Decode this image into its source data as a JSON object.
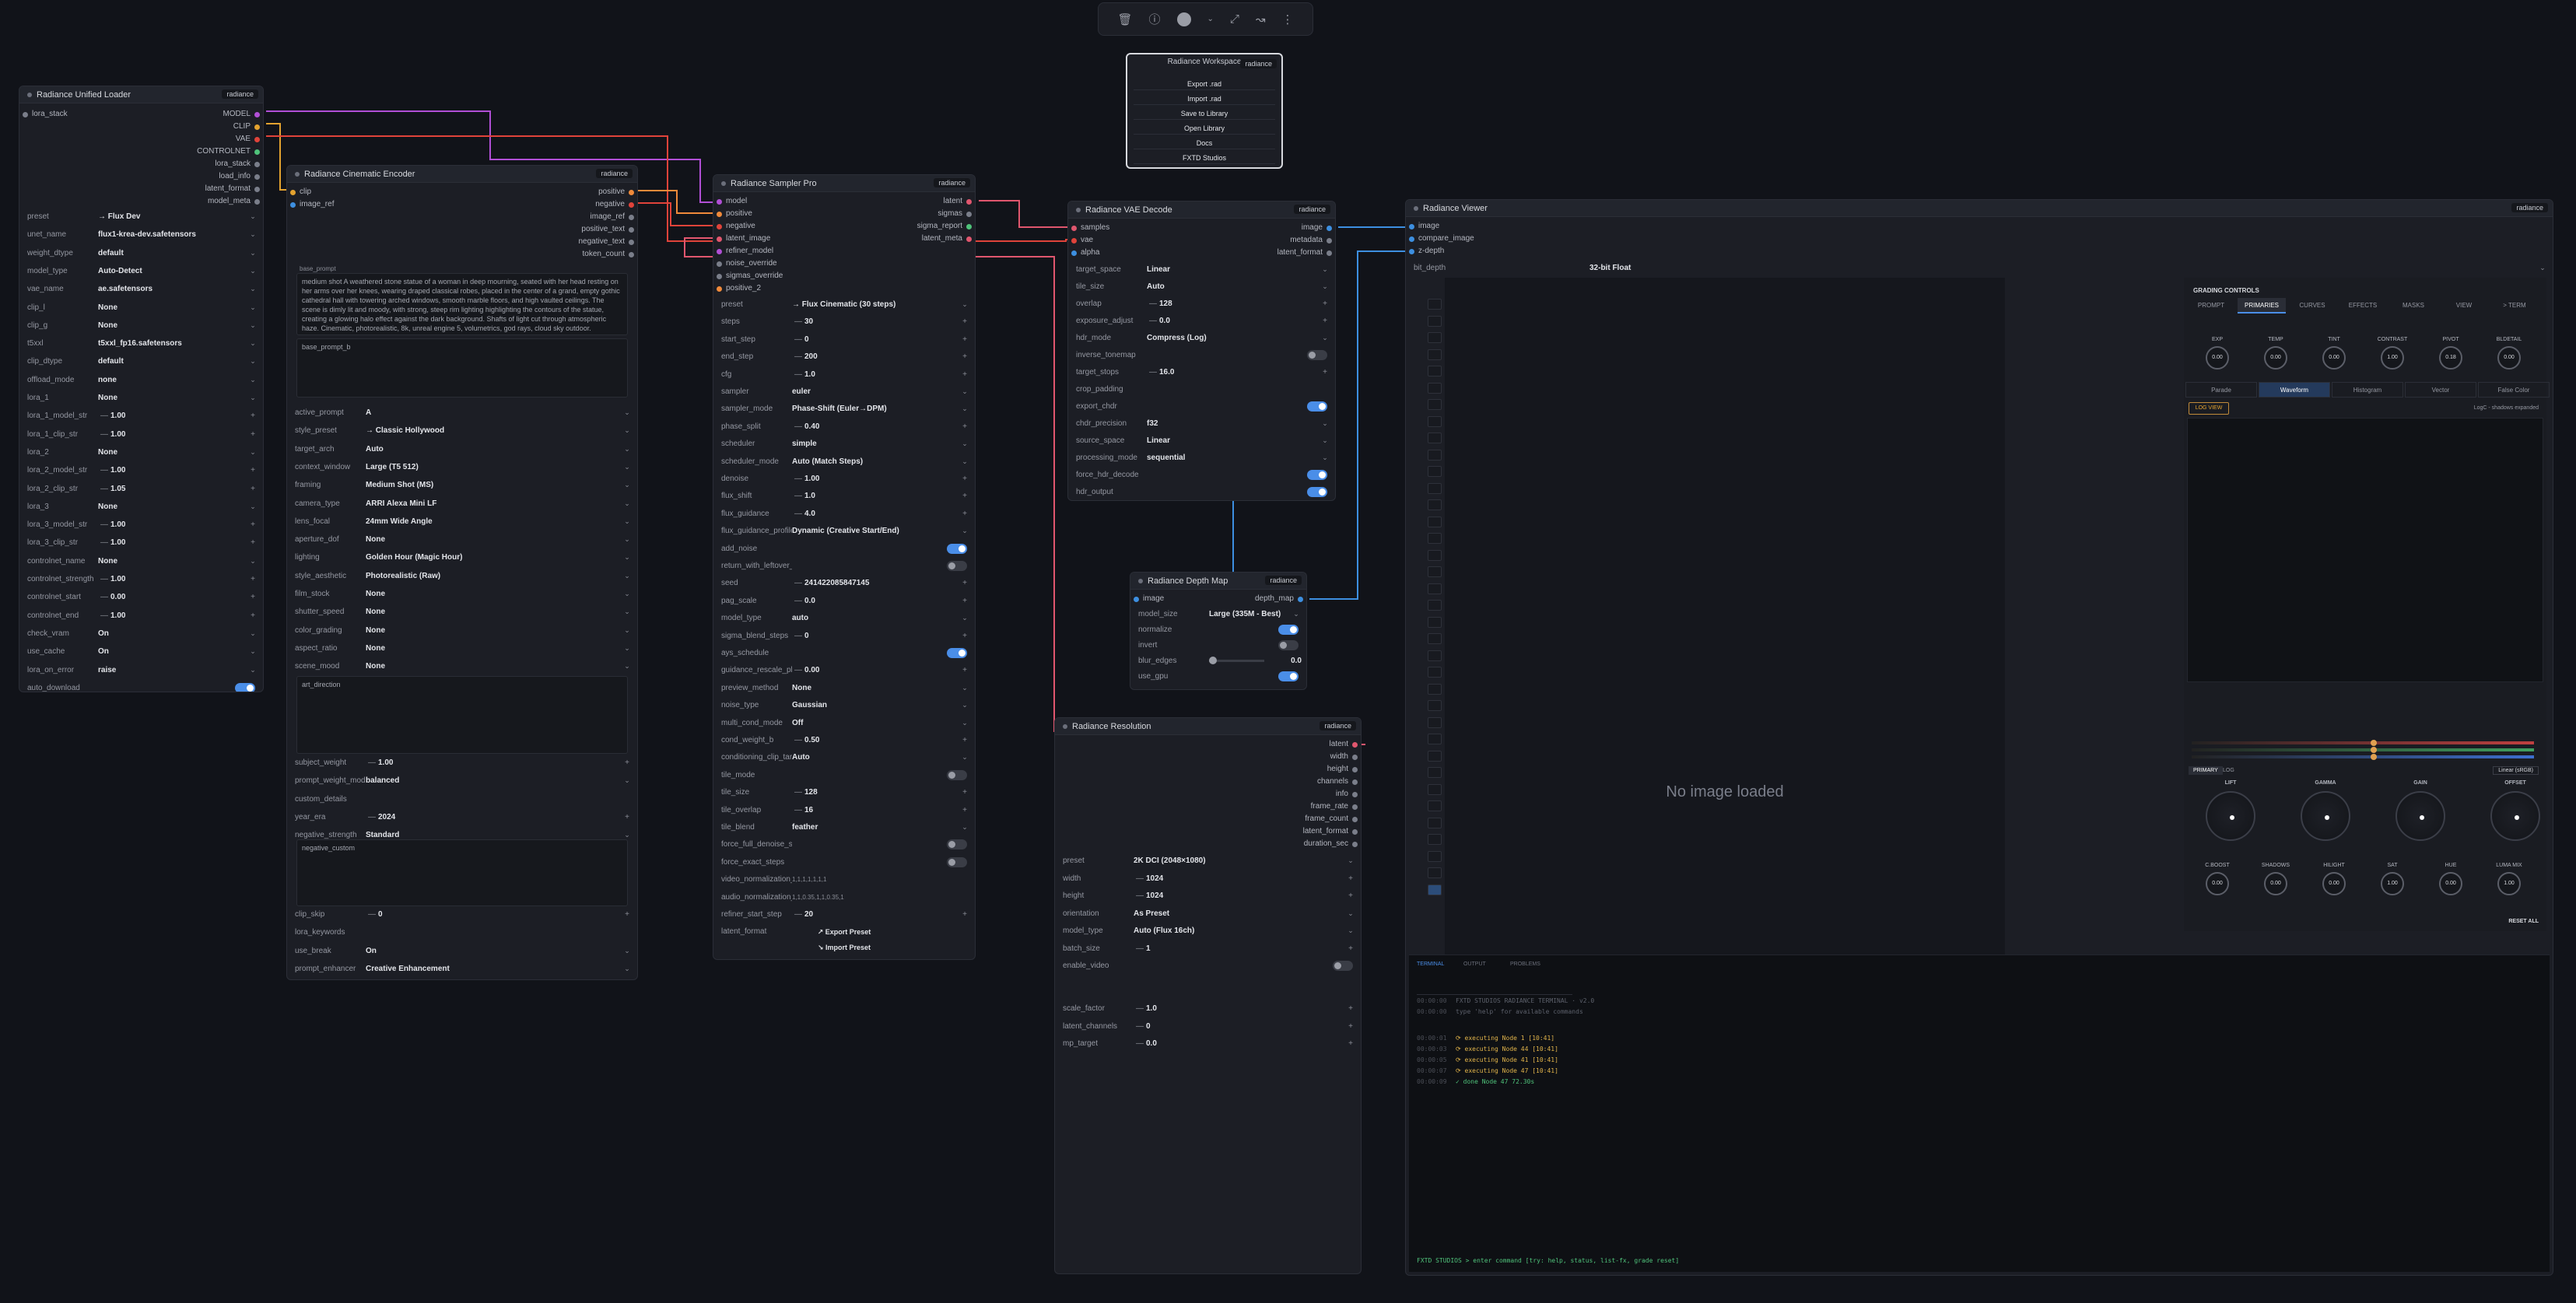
{
  "toolbar": {
    "icons": [
      "trash-icon",
      "info-icon",
      "color-circle-icon",
      "chevron-down-icon",
      "fit-icon",
      "curve-icon",
      "more-icon"
    ]
  },
  "workspace": {
    "title": "Radiance Workspace",
    "badge": "radiance",
    "items": [
      "Export .rad",
      "Import .rad",
      "Save to Library",
      "Open Library",
      "Docs",
      "FXTD Studios"
    ]
  },
  "loader": {
    "title": "Radiance Unified Loader",
    "badge": "radiance",
    "input": "lora_stack",
    "outputs": [
      "MODEL",
      "CLIP",
      "VAE",
      "CONTROLNET",
      "lora_stack",
      "load_info",
      "latent_format",
      "model_meta"
    ],
    "widgets": [
      {
        "l": "preset",
        "v": "→ Flux Dev",
        "t": "combo"
      },
      {
        "l": "unet_name",
        "v": "flux1-krea-dev.safetensors",
        "t": "combo"
      },
      {
        "l": "weight_dtype",
        "v": "default",
        "t": "combo"
      },
      {
        "l": "model_type",
        "v": "Auto-Detect",
        "t": "combo"
      },
      {
        "l": "vae_name",
        "v": "ae.safetensors",
        "t": "combo"
      },
      {
        "l": "clip_l",
        "v": "None",
        "t": "combo"
      },
      {
        "l": "clip_g",
        "v": "None",
        "t": "combo"
      },
      {
        "l": "t5xxl",
        "v": "t5xxl_fp16.safetensors",
        "t": "combo"
      },
      {
        "l": "clip_dtype",
        "v": "default",
        "t": "combo"
      },
      {
        "l": "offload_mode",
        "v": "none",
        "t": "combo"
      },
      {
        "l": "lora_1",
        "v": "None",
        "t": "combo"
      },
      {
        "l": "lora_1_model_str",
        "v": "1.00",
        "t": "num"
      },
      {
        "l": "lora_1_clip_str",
        "v": "1.00",
        "t": "num"
      },
      {
        "l": "lora_2",
        "v": "None",
        "t": "combo"
      },
      {
        "l": "lora_2_model_str",
        "v": "1.00",
        "t": "num"
      },
      {
        "l": "lora_2_clip_str",
        "v": "1.05",
        "t": "num"
      },
      {
        "l": "lora_3",
        "v": "None",
        "t": "combo"
      },
      {
        "l": "lora_3_model_str",
        "v": "1.00",
        "t": "num"
      },
      {
        "l": "lora_3_clip_str",
        "v": "1.00",
        "t": "num"
      },
      {
        "l": "controlnet_name",
        "v": "None",
        "t": "combo"
      },
      {
        "l": "controlnet_strength",
        "v": "1.00",
        "t": "num"
      },
      {
        "l": "controlnet_start",
        "v": "0.00",
        "t": "num"
      },
      {
        "l": "controlnet_end",
        "v": "1.00",
        "t": "num"
      },
      {
        "l": "check_vram",
        "v": "On",
        "t": "combo"
      },
      {
        "l": "use_cache",
        "v": "On",
        "t": "combo"
      },
      {
        "l": "lora_on_error",
        "v": "raise",
        "t": "combo"
      },
      {
        "l": "auto_download",
        "v": "",
        "t": "toggle_on"
      }
    ]
  },
  "encoder": {
    "title": "Radiance Cinematic Encoder",
    "badge": "radiance",
    "inputs": [
      "clip",
      "image_ref"
    ],
    "outputs": [
      "positive",
      "negative",
      "image_ref",
      "positive_text",
      "negative_text",
      "token_count"
    ],
    "base_prompt_label": "base_prompt",
    "base_prompt": "medium shot A weathered stone statue of a woman in deep mourning, seated with her head resting on her arms over her knees, wearing draped classical robes, placed in the center of a grand, empty gothic cathedral hall with towering arched windows, smooth marble floors, and high vaulted ceilings. The scene is dimly lit and moody, with strong, steep rim lighting highlighting the contours of the statue, creating a glowing halo effect against the dark background. Shafts of light cut through atmospheric haze. Cinematic, photorealistic, 8k, unreal engine 5, volumetrics, god rays, cloud sky outdoor.",
    "base_prompt_b": "base_prompt_b",
    "widgets": [
      {
        "l": "active_prompt",
        "v": "A",
        "t": "combo"
      },
      {
        "l": "style_preset",
        "v": "→ Classic Hollywood",
        "t": "combo"
      },
      {
        "l": "target_arch",
        "v": "Auto",
        "t": "combo"
      },
      {
        "l": "context_window",
        "v": "Large (T5 512)",
        "t": "combo"
      },
      {
        "l": "framing",
        "v": "Medium Shot (MS)",
        "t": "combo"
      },
      {
        "l": "camera_type",
        "v": "ARRI Alexa Mini LF",
        "t": "combo"
      },
      {
        "l": "lens_focal",
        "v": "24mm Wide Angle",
        "t": "combo"
      },
      {
        "l": "aperture_dof",
        "v": "None",
        "t": "combo"
      },
      {
        "l": "lighting",
        "v": "Golden Hour (Magic Hour)",
        "t": "combo"
      },
      {
        "l": "style_aesthetic",
        "v": "Photorealistic (Raw)",
        "t": "combo"
      },
      {
        "l": "film_stock",
        "v": "None",
        "t": "combo"
      },
      {
        "l": "shutter_speed",
        "v": "None",
        "t": "combo"
      },
      {
        "l": "color_grading",
        "v": "None",
        "t": "combo"
      },
      {
        "l": "aspect_ratio",
        "v": "None",
        "t": "combo"
      },
      {
        "l": "scene_mood",
        "v": "None",
        "t": "combo"
      }
    ],
    "art_direction": "art_direction",
    "widgets2": [
      {
        "l": "subject_weight",
        "v": "1.00",
        "t": "num"
      },
      {
        "l": "prompt_weight_mode",
        "v": "balanced",
        "t": "combo"
      },
      {
        "l": "custom_details",
        "v": "",
        "t": "label"
      },
      {
        "l": "year_era",
        "v": "2024",
        "t": "num"
      },
      {
        "l": "negative_strength",
        "v": "Standard",
        "t": "combo"
      }
    ],
    "negative_custom": "negative_custom",
    "widgets3": [
      {
        "l": "clip_skip",
        "v": "0",
        "t": "num"
      },
      {
        "l": "lora_keywords",
        "v": "",
        "t": "label"
      },
      {
        "l": "use_break",
        "v": "On",
        "t": "combo"
      },
      {
        "l": "prompt_enhancer",
        "v": "Creative Enhancement",
        "t": "combo"
      }
    ]
  },
  "sampler": {
    "title": "Radiance Sampler Pro",
    "badge": "radiance",
    "inputs": [
      "model",
      "positive",
      "negative",
      "latent_image",
      "refiner_model",
      "noise_override",
      "sigmas_override",
      "positive_2"
    ],
    "outputs": [
      "latent",
      "sigmas",
      "sigma_report",
      "latent_meta"
    ],
    "widgets": [
      {
        "l": "preset",
        "v": "→ Flux Cinematic (30 steps)",
        "t": "combo"
      },
      {
        "l": "steps",
        "v": "30",
        "t": "num"
      },
      {
        "l": "start_step",
        "v": "0",
        "t": "num"
      },
      {
        "l": "end_step",
        "v": "200",
        "t": "num"
      },
      {
        "l": "cfg",
        "v": "1.0",
        "t": "num"
      },
      {
        "l": "sampler",
        "v": "euler",
        "t": "combo"
      },
      {
        "l": "sampler_mode",
        "v": "Phase-Shift (Euler→DPM)",
        "t": "combo"
      },
      {
        "l": "phase_split",
        "v": "0.40",
        "t": "num"
      },
      {
        "l": "scheduler",
        "v": "simple",
        "t": "combo"
      },
      {
        "l": "scheduler_mode",
        "v": "Auto (Match Steps)",
        "t": "combo"
      },
      {
        "l": "denoise",
        "v": "1.00",
        "t": "num"
      },
      {
        "l": "flux_shift",
        "v": "1.0",
        "t": "num"
      },
      {
        "l": "flux_guidance",
        "v": "4.0",
        "t": "num"
      },
      {
        "l": "flux_guidance_profile",
        "v": "Dynamic (Creative Start/End)",
        "t": "combo"
      },
      {
        "l": "add_noise",
        "v": "",
        "t": "toggle_on"
      },
      {
        "l": "return_with_leftover_noise",
        "v": "",
        "t": "toggle_off"
      },
      {
        "l": "seed",
        "v": "241422085847145",
        "t": "num"
      },
      {
        "l": "pag_scale",
        "v": "0.0",
        "t": "num"
      },
      {
        "l": "model_type",
        "v": "auto",
        "t": "combo"
      },
      {
        "l": "sigma_blend_steps",
        "v": "0",
        "t": "num"
      },
      {
        "l": "ays_schedule",
        "v": "",
        "t": "toggle_on"
      },
      {
        "l": "guidance_rescale_phi",
        "v": "0.00",
        "t": "num"
      },
      {
        "l": "preview_method",
        "v": "None",
        "t": "combo"
      },
      {
        "l": "noise_type",
        "v": "Gaussian",
        "t": "combo"
      },
      {
        "l": "multi_cond_mode",
        "v": "Off",
        "t": "combo"
      },
      {
        "l": "cond_weight_b",
        "v": "0.50",
        "t": "num"
      },
      {
        "l": "conditioning_clip_target",
        "v": "Auto",
        "t": "combo"
      },
      {
        "l": "tile_mode",
        "v": "",
        "t": "toggle_off"
      },
      {
        "l": "tile_size",
        "v": "128",
        "t": "num"
      },
      {
        "l": "tile_overlap",
        "v": "16",
        "t": "num"
      },
      {
        "l": "tile_blend",
        "v": "feather",
        "t": "combo"
      },
      {
        "l": "force_full_denoise_steps",
        "v": "",
        "t": "toggle_off"
      },
      {
        "l": "force_exact_steps",
        "v": "",
        "t": "toggle_off"
      },
      {
        "l": "video_normalization_factors",
        "v": "1,1,1,1,1,1,1",
        "t": "text"
      },
      {
        "l": "audio_normalization_factors",
        "v": "1,1,0.35,1,1,0.35,1",
        "t": "text"
      },
      {
        "l": "refiner_start_step",
        "v": "20",
        "t": "num"
      },
      {
        "l": "latent_format",
        "v": "",
        "t": "label"
      }
    ],
    "export_preset": "↗ Export Preset",
    "import_preset": "↘ Import Preset"
  },
  "vae": {
    "title": "Radiance VAE Decode",
    "badge": "radiance",
    "inputs": [
      "samples",
      "vae",
      "alpha"
    ],
    "outputs": [
      "image",
      "metadata",
      "latent_format"
    ],
    "widgets": [
      {
        "l": "target_space",
        "v": "Linear",
        "t": "combo"
      },
      {
        "l": "tile_size",
        "v": "Auto",
        "t": "combo"
      },
      {
        "l": "overlap",
        "v": "128",
        "t": "num"
      },
      {
        "l": "exposure_adjust",
        "v": "0.0",
        "t": "num"
      },
      {
        "l": "hdr_mode",
        "v": "Compress (Log)",
        "t": "combo"
      },
      {
        "l": "inverse_tonemap",
        "v": "",
        "t": "toggle_off"
      },
      {
        "l": "target_stops",
        "v": "16.0",
        "t": "num"
      },
      {
        "l": "crop_padding",
        "v": "",
        "t": "label"
      },
      {
        "l": "export_chdr",
        "v": "",
        "t": "toggle_on"
      },
      {
        "l": "chdr_precision",
        "v": "f32",
        "t": "combo"
      },
      {
        "l": "source_space",
        "v": "Linear",
        "t": "combo"
      },
      {
        "l": "processing_mode",
        "v": "sequential",
        "t": "combo"
      },
      {
        "l": "force_hdr_decode",
        "v": "",
        "t": "toggle_on"
      },
      {
        "l": "hdr_output",
        "v": "",
        "t": "toggle_on"
      }
    ]
  },
  "depth": {
    "title": "Radiance Depth Map",
    "badge": "radiance",
    "input": "image",
    "output": "depth_map",
    "widgets": [
      {
        "l": "model_size",
        "v": "Large (335M - Best)",
        "t": "combo"
      },
      {
        "l": "normalize",
        "v": "",
        "t": "toggle_on"
      },
      {
        "l": "invert",
        "v": "",
        "t": "toggle_off"
      },
      {
        "l": "blur_edges",
        "v": "0.0",
        "t": "slider"
      },
      {
        "l": "use_gpu",
        "v": "",
        "t": "toggle_on"
      }
    ]
  },
  "resolution": {
    "title": "Radiance Resolution",
    "badge": "radiance",
    "outputs": [
      "latent",
      "width",
      "height",
      "channels",
      "info",
      "frame_rate",
      "frame_count",
      "latent_format",
      "duration_sec"
    ],
    "widgets": [
      {
        "l": "preset",
        "v": "2K DCI (2048×1080)",
        "t": "combo"
      },
      {
        "l": "width",
        "v": "1024",
        "t": "num"
      },
      {
        "l": "height",
        "v": "1024",
        "t": "num"
      },
      {
        "l": "orientation",
        "v": "As Preset",
        "t": "combo"
      },
      {
        "l": "model_type",
        "v": "Auto (Flux 16ch)",
        "t": "combo"
      },
      {
        "l": "batch_size",
        "v": "1",
        "t": "num"
      },
      {
        "l": "enable_video",
        "v": "",
        "t": "toggle_off"
      }
    ],
    "widgets2": [
      {
        "l": "scale_factor",
        "v": "1.0",
        "t": "num"
      },
      {
        "l": "latent_channels",
        "v": "0",
        "t": "num"
      },
      {
        "l": "mp_target",
        "v": "0.0",
        "t": "num"
      }
    ]
  },
  "viewer": {
    "title": "Radiance Viewer",
    "badge": "radiance",
    "inputs": [
      "image",
      "compare_image",
      "z-depth"
    ],
    "bit_depth_label": "bit_depth",
    "bit_depth": "32-bit Float",
    "no_image": "No image loaded",
    "grading_title": "GRADING CONTROLS",
    "tabs": [
      "PROMPT",
      "PRIMARIES",
      "CURVES",
      "EFFECTS",
      "MASKS",
      "VIEW",
      "> TERM"
    ],
    "knobs1": [
      {
        "l": "EXP",
        "v": "0.00"
      },
      {
        "l": "TEMP",
        "v": "0.00"
      },
      {
        "l": "TINT",
        "v": "0.00"
      },
      {
        "l": "CONTRAST",
        "v": "1.00"
      },
      {
        "l": "PIVOT",
        "v": "0.18"
      },
      {
        "l": "BLDETAIL",
        "v": "0.00"
      }
    ],
    "scope_tabs": [
      "Parade",
      "Waveform",
      "Histogram",
      "Vector",
      "False Color"
    ],
    "log_view": "LOG VIEW",
    "log_info": "LogC - shadows expanded",
    "primary_tab": "PRIMARY",
    "log_tab": "LOG",
    "color_space": "Linear (sRGB)",
    "wheels": [
      "LIFT",
      "GAMMA",
      "GAIN",
      "OFFSET"
    ],
    "knobs2": [
      {
        "l": "C.BOOST",
        "v": "0.00"
      },
      {
        "l": "SHADOWS",
        "v": "0.00"
      },
      {
        "l": "HILIGHT",
        "v": "0.00"
      },
      {
        "l": "SAT",
        "v": "1.00"
      },
      {
        "l": "HUE",
        "v": "0.00"
      },
      {
        "l": "LUMA MIX",
        "v": "1.00"
      }
    ],
    "reset_all": "RESET ALL",
    "term_tabs": [
      "TERMINAL",
      "OUTPUT",
      "PROBLEMS"
    ],
    "log_lines": [
      {
        "t": "00:00:00",
        "m": "FXTD STUDIOS RADIANCE TERMINAL · v2.0",
        "c": "#5c606b"
      },
      {
        "t": "00:00:00",
        "m": "type 'help' for available commands",
        "c": "#5c606b"
      },
      {
        "t": "00:00:01",
        "m": "⟳ executing   Node 1  [10:41]",
        "c": "#e0b34a"
      },
      {
        "t": "00:00:03",
        "m": "⟳ executing   Node 44  [10:41]",
        "c": "#e0b34a"
      },
      {
        "t": "00:00:05",
        "m": "⟳ executing   Node 41  [10:41]",
        "c": "#e0b34a"
      },
      {
        "t": "00:00:07",
        "m": "⟳ executing   Node 47  [10:41]",
        "c": "#e0b34a"
      },
      {
        "t": "00:00:09",
        "m": "✓ done        Node 47  72.30s",
        "c": "#4fc27a"
      }
    ],
    "prompt_line": "FXTD STUDIOS > enter command [try: help, status, list-fx, grade reset]"
  },
  "colors": {
    "model": "#b14fd6",
    "clip": "#e3a22f",
    "vae": "#e0433a",
    "latent": "#e0566e",
    "image": "#3d8fe0",
    "cond": "#f08a3a",
    "control": "#4fc27a"
  }
}
